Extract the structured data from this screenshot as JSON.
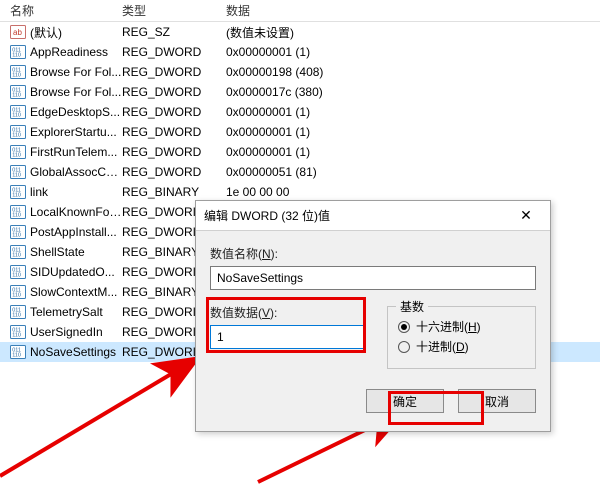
{
  "headers": {
    "name": "名称",
    "type": "类型",
    "data": "数据"
  },
  "rows": [
    {
      "icon": "ab",
      "name": "(默认)",
      "type": "REG_SZ",
      "data": "(数值未设置)"
    },
    {
      "icon": "num",
      "name": "AppReadiness",
      "type": "REG_DWORD",
      "data": "0x00000001 (1)"
    },
    {
      "icon": "num",
      "name": "Browse For Fol...",
      "type": "REG_DWORD",
      "data": "0x00000198 (408)"
    },
    {
      "icon": "num",
      "name": "Browse For Fol...",
      "type": "REG_DWORD",
      "data": "0x0000017c (380)"
    },
    {
      "icon": "num",
      "name": "EdgeDesktopS...",
      "type": "REG_DWORD",
      "data": "0x00000001 (1)"
    },
    {
      "icon": "num",
      "name": "ExplorerStartu...",
      "type": "REG_DWORD",
      "data": "0x00000001 (1)"
    },
    {
      "icon": "num",
      "name": "FirstRunTelem...",
      "type": "REG_DWORD",
      "data": "0x00000001 (1)"
    },
    {
      "icon": "num",
      "name": "GlobalAssocCh...",
      "type": "REG_DWORD",
      "data": "0x00000051 (81)"
    },
    {
      "icon": "num",
      "name": "link",
      "type": "REG_BINARY",
      "data": "1e 00 00 00"
    },
    {
      "icon": "num",
      "name": "LocalKnownFol...",
      "type": "REG_DWORI",
      "data": ""
    },
    {
      "icon": "num",
      "name": "PostAppInstall...",
      "type": "REG_DWORI",
      "data": ""
    },
    {
      "icon": "num",
      "name": "ShellState",
      "type": "REG_BINARY",
      "data": ""
    },
    {
      "icon": "num",
      "name": "SIDUpdatedO...",
      "type": "REG_DWORI",
      "data": ""
    },
    {
      "icon": "num",
      "name": "SlowContextM...",
      "type": "REG_BINARY",
      "data": ""
    },
    {
      "icon": "num",
      "name": "TelemetrySalt",
      "type": "REG_DWORI",
      "data": ""
    },
    {
      "icon": "num",
      "name": "UserSignedIn",
      "type": "REG_DWORI",
      "data": ""
    },
    {
      "icon": "num",
      "name": "NoSaveSettings",
      "type": "REG_DWORI",
      "data": "",
      "selected": true
    }
  ],
  "dialog": {
    "title": "编辑 DWORD (32 位)值",
    "name_label_pre": "数值名称(",
    "name_label_u": "N",
    "name_label_post": "):",
    "name_value": "NoSaveSettings",
    "value_label_pre": "数值数据(",
    "value_label_u": "V",
    "value_label_post": "):",
    "value_value": "1",
    "group_label": "基数",
    "radio_hex_pre": "十六进制(",
    "radio_hex_u": "H",
    "radio_hex_post": ")",
    "radio_dec_pre": "十进制(",
    "radio_dec_u": "D",
    "radio_dec_post": ")",
    "ok": "确定",
    "cancel": "取消"
  }
}
